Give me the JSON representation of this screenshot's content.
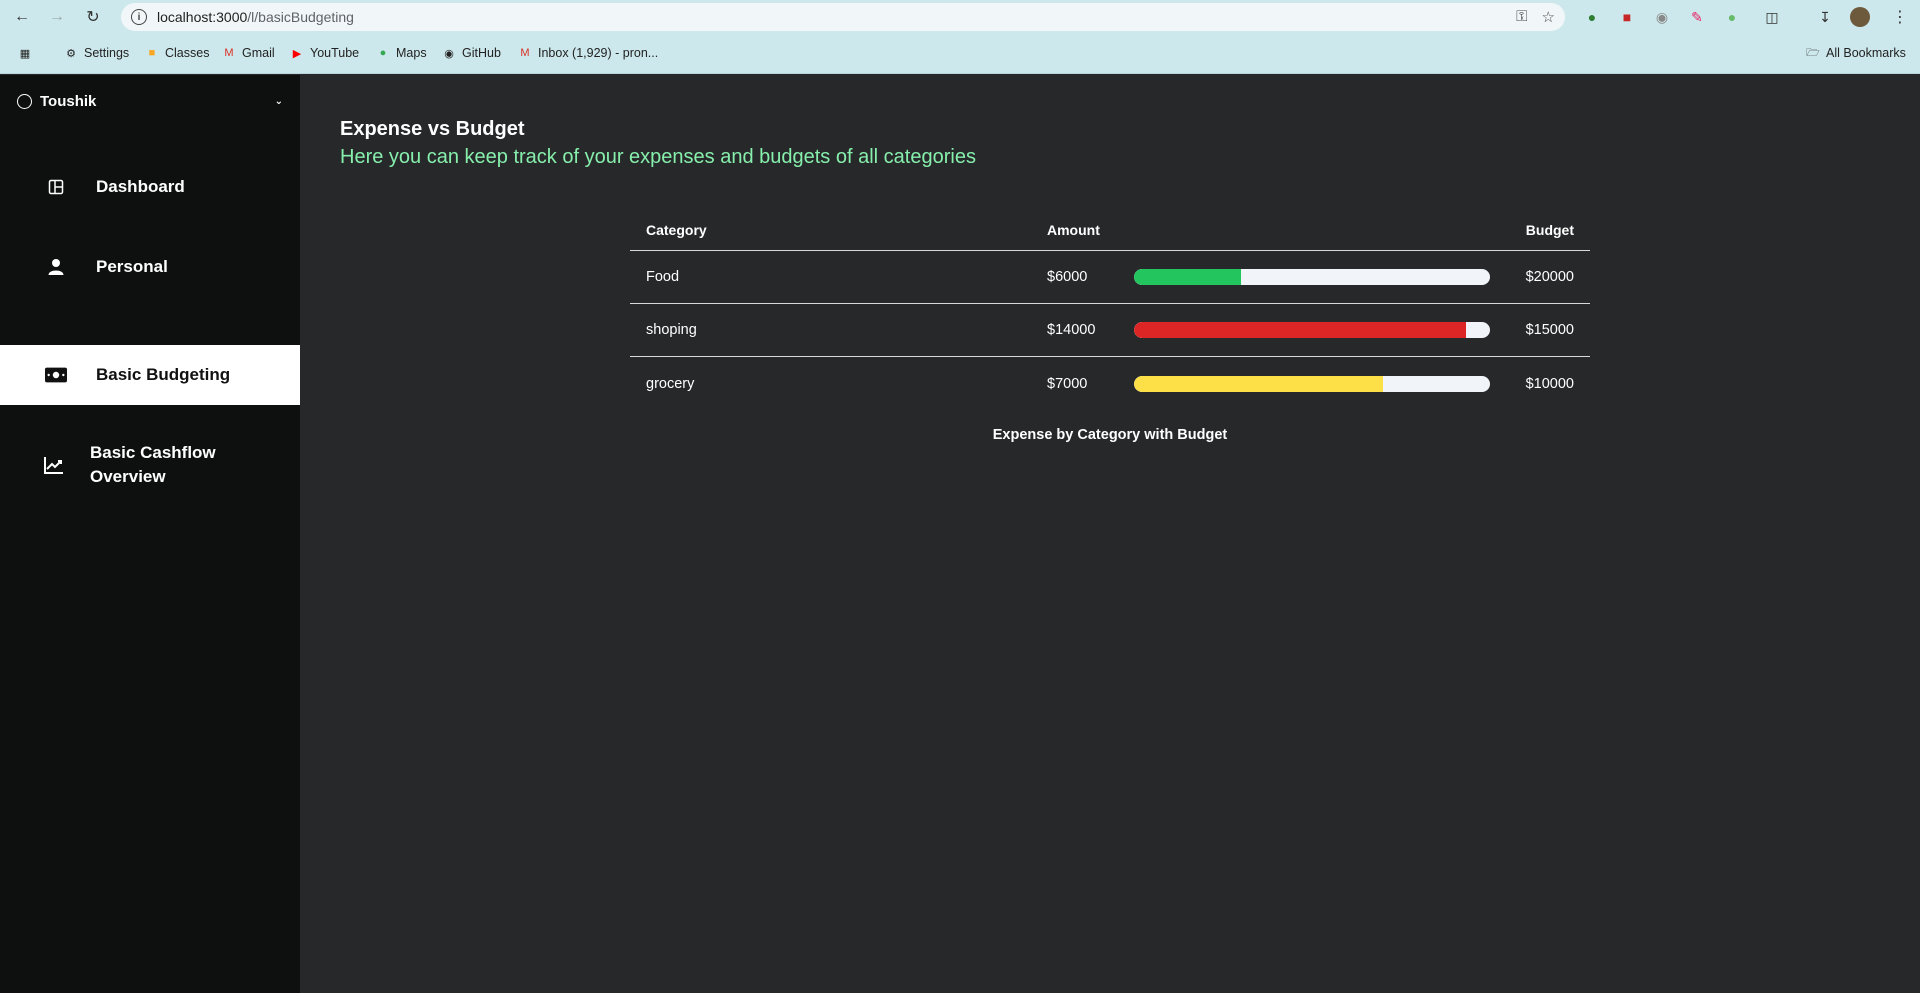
{
  "browser": {
    "url_host": "localhost:3000",
    "url_path": "/l/basicBudgeting",
    "bookmarks": [
      "Settings",
      "Classes",
      "Gmail",
      "YouTube",
      "Maps",
      "GitHub",
      "Inbox (1,929) - pron..."
    ],
    "all_bookmarks": "All Bookmarks"
  },
  "sidebar": {
    "user": "Toushik",
    "items": [
      {
        "label": "Dashboard",
        "icon": "dashboard-icon"
      },
      {
        "label": "Personal",
        "icon": "person-icon"
      },
      {
        "label": "Basic Budgeting",
        "icon": "money-icon",
        "active": true
      },
      {
        "label": "Basic Cashflow Overview",
        "icon": "chart-line-icon"
      }
    ]
  },
  "page": {
    "title": "Expense vs Budget",
    "subtitle": "Here you can keep track of your expenses and budgets of all categories"
  },
  "table": {
    "headers": {
      "category": "Category",
      "amount": "Amount",
      "budget": "Budget"
    },
    "rows": [
      {
        "category": "Food",
        "amount": "$6000",
        "budget": "$20000",
        "progress": 0.3,
        "color": "#22c55e"
      },
      {
        "category": "shoping",
        "amount": "$14000",
        "budget": "$15000",
        "progress": 0.933,
        "color": "#dc2626"
      },
      {
        "category": "grocery",
        "amount": "$7000",
        "budget": "$10000",
        "progress": 0.7,
        "color": "#fde047"
      }
    ],
    "caption": "Expense by Category with Budget"
  }
}
